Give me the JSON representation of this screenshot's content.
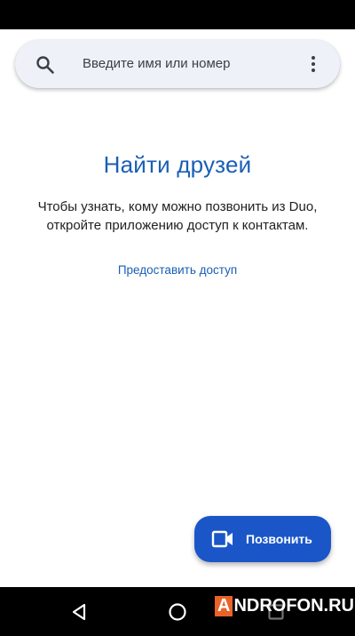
{
  "search": {
    "placeholder": "Введите имя или номер"
  },
  "content": {
    "title": "Найти друзей",
    "description": "Чтобы узнать, кому можно позвонить из Duo, откройте приложению доступ к контактам.",
    "grant_access_link": "Предоставить доступ"
  },
  "fab": {
    "label": "Позвонить",
    "icon": "videocam-icon",
    "color": "#1a56c8"
  },
  "navigation": {
    "back_icon": "back-triangle-icon",
    "home_icon": "home-circle-icon",
    "recents_icon": "recents-square-icon"
  },
  "watermark": {
    "first_letter": "A",
    "rest": "NDROFON.RU"
  },
  "colors": {
    "accent": "#1a5fb4",
    "search_bg": "#eef1f8"
  }
}
